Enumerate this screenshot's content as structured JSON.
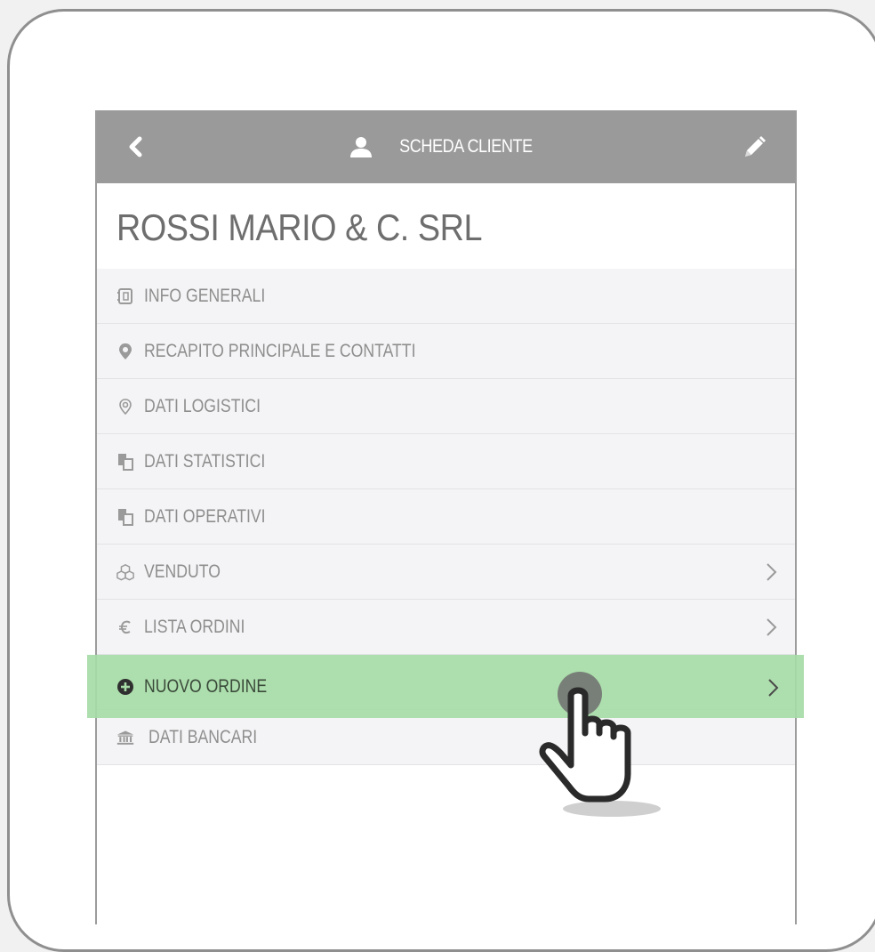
{
  "header": {
    "title": "SCHEDA CLIENTE",
    "back_icon": "chevron-left-icon",
    "user_icon": "user-icon",
    "edit_icon": "pencil-icon"
  },
  "client": {
    "name": "ROSSI MARIO & C. SRL"
  },
  "menu": {
    "items": [
      {
        "label": "INFO GENERALI",
        "icon": "address-book-icon",
        "chevron": false
      },
      {
        "label": "RECAPITO PRINCIPALE E CONTATTI",
        "icon": "map-marker-icon",
        "chevron": false
      },
      {
        "label": "DATI LOGISTICI",
        "icon": "location-outline-icon",
        "chevron": false
      },
      {
        "label": "DATI STATISTICI",
        "icon": "documents-icon",
        "chevron": false
      },
      {
        "label": "DATI OPERATIVI",
        "icon": "documents-icon",
        "chevron": false
      },
      {
        "label": "VENDUTO",
        "icon": "cubes-icon",
        "chevron": true
      },
      {
        "label": "LISTA ORDINI",
        "icon": "euro-icon",
        "chevron": true
      },
      {
        "label": "NUOVO ORDINE",
        "icon": "plus-circle-icon",
        "chevron": true,
        "highlighted": true
      },
      {
        "label": "DATI BANCARI",
        "icon": "bank-icon",
        "chevron": false
      }
    ]
  },
  "colors": {
    "header_bg": "#9a9a9a",
    "menu_bg": "#f4f4f6",
    "highlight": "#a6dba6",
    "text_muted": "#8e8e8e"
  },
  "cursor_icon": "tap-hand-icon"
}
